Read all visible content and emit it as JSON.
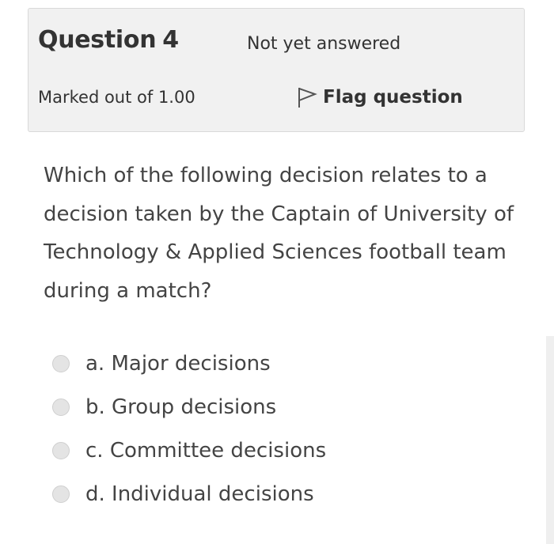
{
  "question_info": {
    "label": "Question",
    "number": "4",
    "state": "Not yet answered",
    "grade": "Marked out of 1.00",
    "flag_label": "Flag question",
    "flag_icon": "flag-outline-icon"
  },
  "question": {
    "text": "Which of the following decision relates to a decision taken by the Captain of University of Technology & Applied Sciences football team during a match?",
    "answers": [
      {
        "label": "a. Major decisions",
        "selected": false
      },
      {
        "label": "b. Group decisions",
        "selected": false
      },
      {
        "label": "c. Committee decisions",
        "selected": false
      },
      {
        "label": "d. Individual decisions",
        "selected": false
      }
    ]
  },
  "colors": {
    "info_background": "#f1f1f1",
    "text": "#333333",
    "radio_fill": "#e4e4e4"
  }
}
